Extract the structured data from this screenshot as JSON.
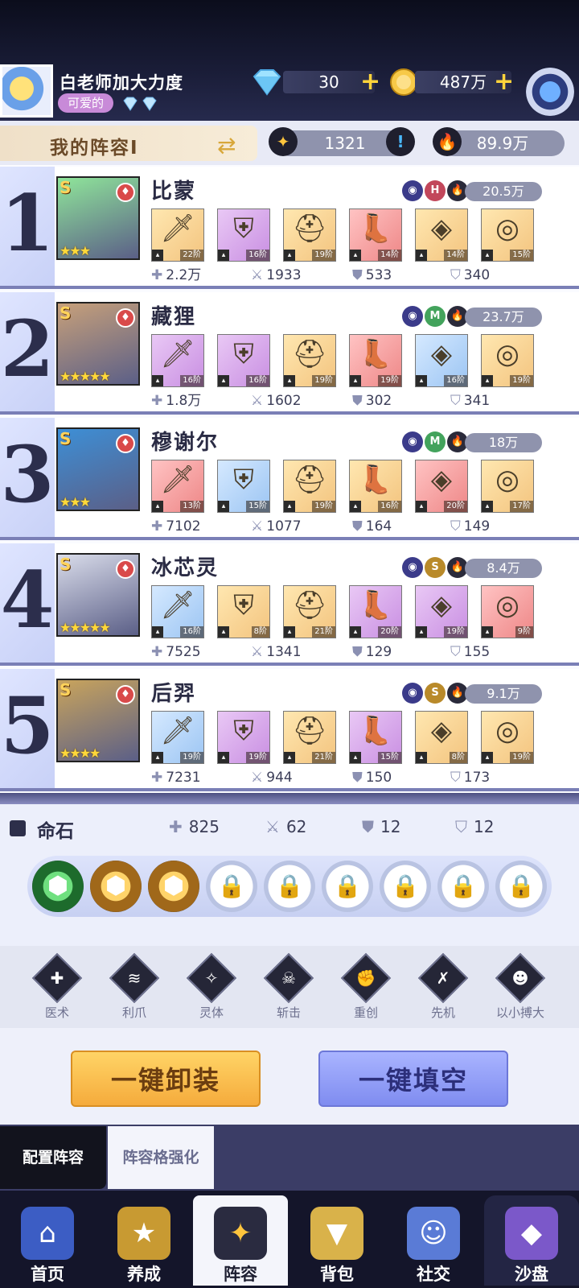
{
  "player": {
    "name": "白老师加大力度",
    "tag": "可爱的"
  },
  "resources": {
    "diamonds": "30",
    "gold": "487万"
  },
  "lineup": {
    "title": "我的阵容Ⅰ",
    "fate_value": "1321",
    "power": "89.9万"
  },
  "heroes": [
    {
      "rank": "1",
      "name": "比蒙",
      "power": "20.5万",
      "stars": "★★★",
      "tags": [
        "H"
      ],
      "portrait_color": "#8fe59a",
      "equipment": [
        {
          "level": "22阶",
          "bg": "gold"
        },
        {
          "level": "16阶",
          "bg": "purple"
        },
        {
          "level": "19阶",
          "bg": "gold"
        },
        {
          "level": "14阶",
          "bg": "red"
        },
        {
          "level": "14阶",
          "bg": "gold"
        },
        {
          "level": "15阶",
          "bg": "gold"
        }
      ],
      "stats": [
        "2.2万",
        "1933",
        "533",
        "340"
      ]
    },
    {
      "rank": "2",
      "name": "藏狸",
      "power": "23.7万",
      "stars": "★★★★★",
      "tags": [
        "M"
      ],
      "portrait_color": "#c7a07a",
      "equipment": [
        {
          "level": "16阶",
          "bg": "purple"
        },
        {
          "level": "16阶",
          "bg": "purple"
        },
        {
          "level": "19阶",
          "bg": "gold"
        },
        {
          "level": "19阶",
          "bg": "red"
        },
        {
          "level": "16阶",
          "bg": "blue"
        },
        {
          "level": "19阶",
          "bg": "gold"
        }
      ],
      "stats": [
        "1.8万",
        "1602",
        "302",
        "341"
      ]
    },
    {
      "rank": "3",
      "name": "穆谢尔",
      "power": "18万",
      "stars": "★★★",
      "tags": [
        "M"
      ],
      "portrait_color": "#3d8fd6",
      "equipment": [
        {
          "level": "13阶",
          "bg": "red"
        },
        {
          "level": "15阶",
          "bg": "blue"
        },
        {
          "level": "19阶",
          "bg": "gold"
        },
        {
          "level": "16阶",
          "bg": "gold"
        },
        {
          "level": "20阶",
          "bg": "red"
        },
        {
          "level": "17阶",
          "bg": "gold"
        }
      ],
      "stats": [
        "7102",
        "1077",
        "164",
        "149"
      ]
    },
    {
      "rank": "4",
      "name": "冰芯灵",
      "power": "8.4万",
      "stars": "★★★★★",
      "tags": [
        "S"
      ],
      "portrait_color": "#d9dcea",
      "equipment": [
        {
          "level": "16阶",
          "bg": "blue"
        },
        {
          "level": "8阶",
          "bg": "gold"
        },
        {
          "level": "21阶",
          "bg": "gold"
        },
        {
          "level": "20阶",
          "bg": "purple"
        },
        {
          "level": "19阶",
          "bg": "purple"
        },
        {
          "level": "9阶",
          "bg": "red"
        }
      ],
      "stats": [
        "7525",
        "1341",
        "129",
        "155"
      ]
    },
    {
      "rank": "5",
      "name": "后羿",
      "power": "9.1万",
      "stars": "★★★★",
      "tags": [
        "S"
      ],
      "portrait_color": "#c9a45c",
      "equipment": [
        {
          "level": "19阶",
          "bg": "blue"
        },
        {
          "level": "19阶",
          "bg": "purple"
        },
        {
          "level": "21阶",
          "bg": "gold"
        },
        {
          "level": "15阶",
          "bg": "purple"
        },
        {
          "level": "8阶",
          "bg": "gold"
        },
        {
          "level": "19阶",
          "bg": "gold"
        }
      ],
      "stats": [
        "7231",
        "944",
        "150",
        "173"
      ]
    }
  ],
  "fate_stone": {
    "label": "命石",
    "stats": [
      "825",
      "62",
      "12",
      "12"
    ]
  },
  "skills": [
    "医术",
    "利爪",
    "灵体",
    "斩击",
    "重创",
    "先机",
    "以小搏大"
  ],
  "buttons": {
    "unequip_all": "一键卸装",
    "fill_all": "一键填空"
  },
  "subtabs": {
    "configure": "配置阵容",
    "enhance": "阵容格强化"
  },
  "nav": [
    "首页",
    "养成",
    "阵容",
    "背包",
    "社交",
    "沙盘"
  ],
  "colors": {
    "accent": "#7a7fb6",
    "gold_button": "#f5ab3c",
    "blue_button": "#7f8cf0"
  }
}
